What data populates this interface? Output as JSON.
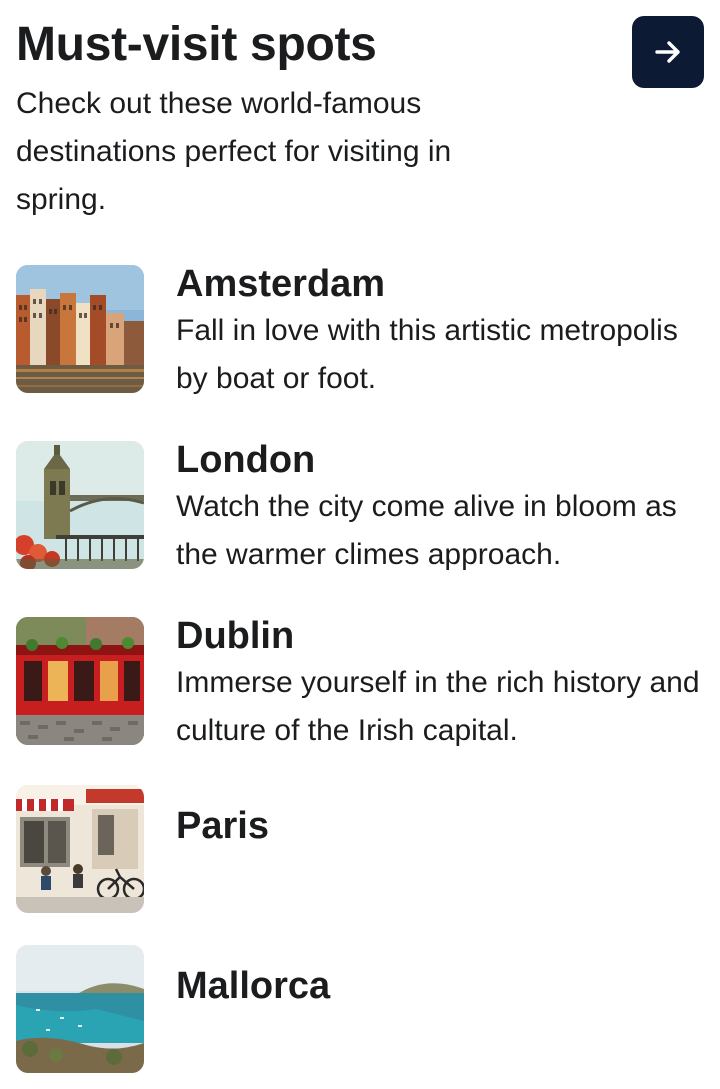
{
  "header": {
    "title": "Must-visit spots",
    "subtitle": "Check out these world-famous destinations perfect for visiting in spring.",
    "next_icon": "arrow-right-icon",
    "accent_color": "#0c1a33"
  },
  "destinations": [
    {
      "name": "Amsterdam",
      "description": "Fall in love with this artistic metropolis by boat or foot.",
      "image": "amsterdam-canal-houses-photo"
    },
    {
      "name": "London",
      "description": "Watch the city come alive in bloom as the warmer climes approach.",
      "image": "tower-bridge-photo"
    },
    {
      "name": "Dublin",
      "description": "Immerse yourself in the rich history and culture of the Irish capital.",
      "image": "red-irish-pub-photo"
    },
    {
      "name": "Paris",
      "description": "",
      "image": "paris-street-cafe-photo"
    },
    {
      "name": "Mallorca",
      "description": "",
      "image": "mallorca-coast-photo"
    }
  ]
}
